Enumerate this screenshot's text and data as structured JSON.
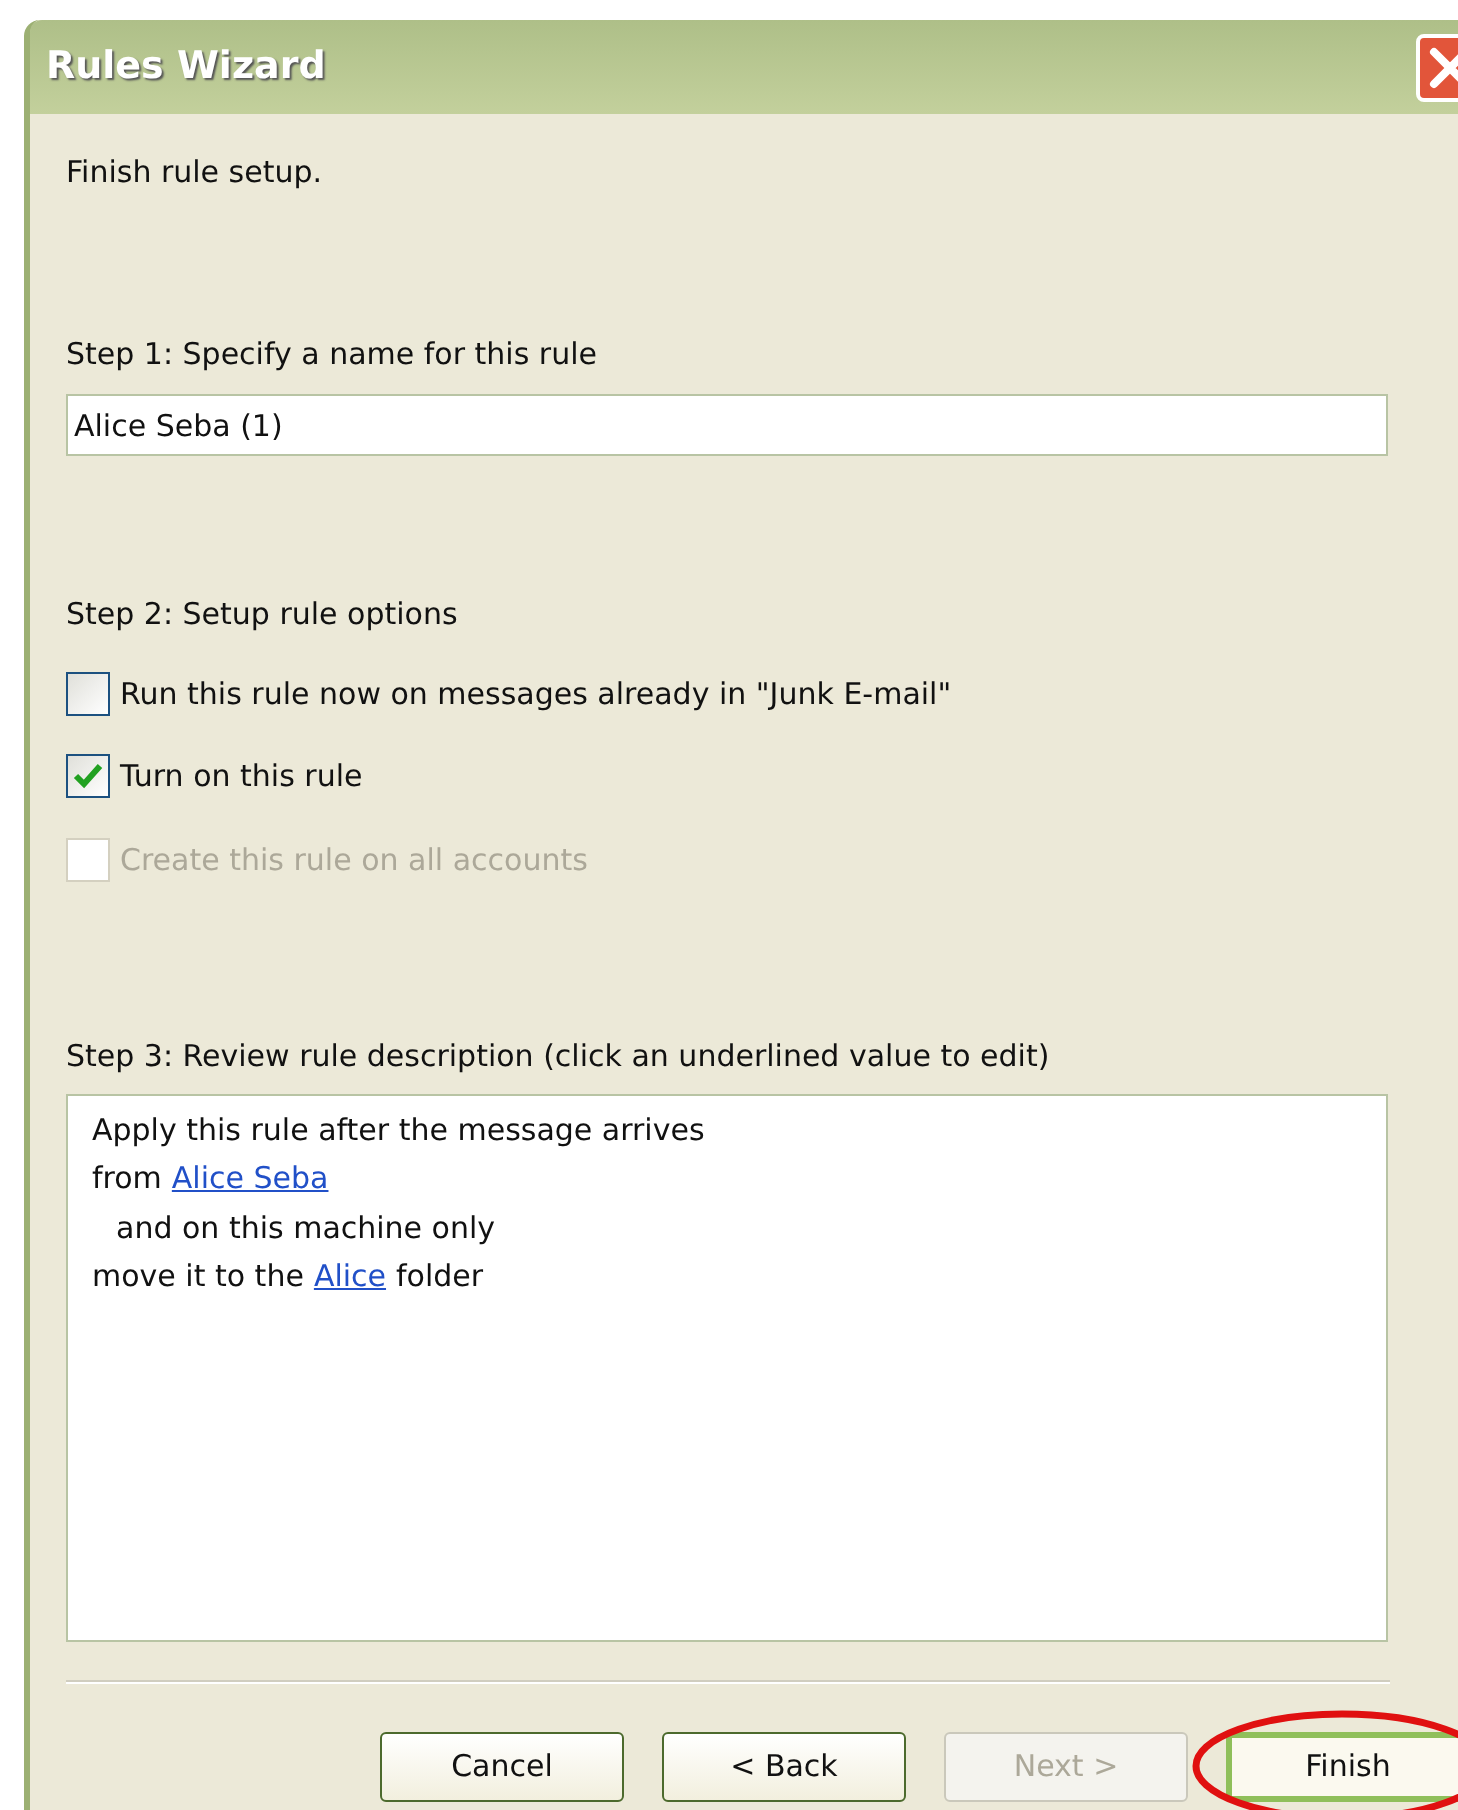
{
  "window": {
    "title": "Rules Wizard"
  },
  "intro": "Finish rule setup.",
  "step1": {
    "label": "Step 1: Specify a name for this rule",
    "value": "Alice Seba (1)"
  },
  "step2": {
    "label": "Step 2: Setup rule options",
    "options": [
      {
        "label": "Run this rule now on messages already in \"Junk E-mail\"",
        "checked": false,
        "disabled": false
      },
      {
        "label": "Turn on this rule",
        "checked": true,
        "disabled": false
      },
      {
        "label": "Create this rule on all accounts",
        "checked": false,
        "disabled": true
      }
    ]
  },
  "step3": {
    "label": "Step 3: Review rule description (click an underlined value to edit)",
    "lines": [
      {
        "indented": false,
        "parts": [
          {
            "kind": "text",
            "text": "Apply this rule after the message arrives"
          }
        ]
      },
      {
        "indented": false,
        "parts": [
          {
            "kind": "text",
            "text": "from"
          },
          {
            "kind": "link",
            "text": "Alice Seba"
          }
        ]
      },
      {
        "indented": true,
        "parts": [
          {
            "kind": "text",
            "text": "and on this machine only"
          }
        ]
      },
      {
        "indented": false,
        "parts": [
          {
            "kind": "text",
            "text": "move it to the"
          },
          {
            "kind": "link",
            "text": "Alice"
          },
          {
            "kind": "text",
            "text": "folder"
          }
        ]
      }
    ]
  },
  "buttons": [
    {
      "label": "Cancel",
      "disabled": false,
      "default": false,
      "highlighted": false
    },
    {
      "label": "< Back",
      "disabled": false,
      "default": false,
      "highlighted": false
    },
    {
      "label": "Next >",
      "disabled": true,
      "default": false,
      "highlighted": false
    },
    {
      "label": "Finish",
      "disabled": false,
      "default": true,
      "highlighted": true
    }
  ]
}
